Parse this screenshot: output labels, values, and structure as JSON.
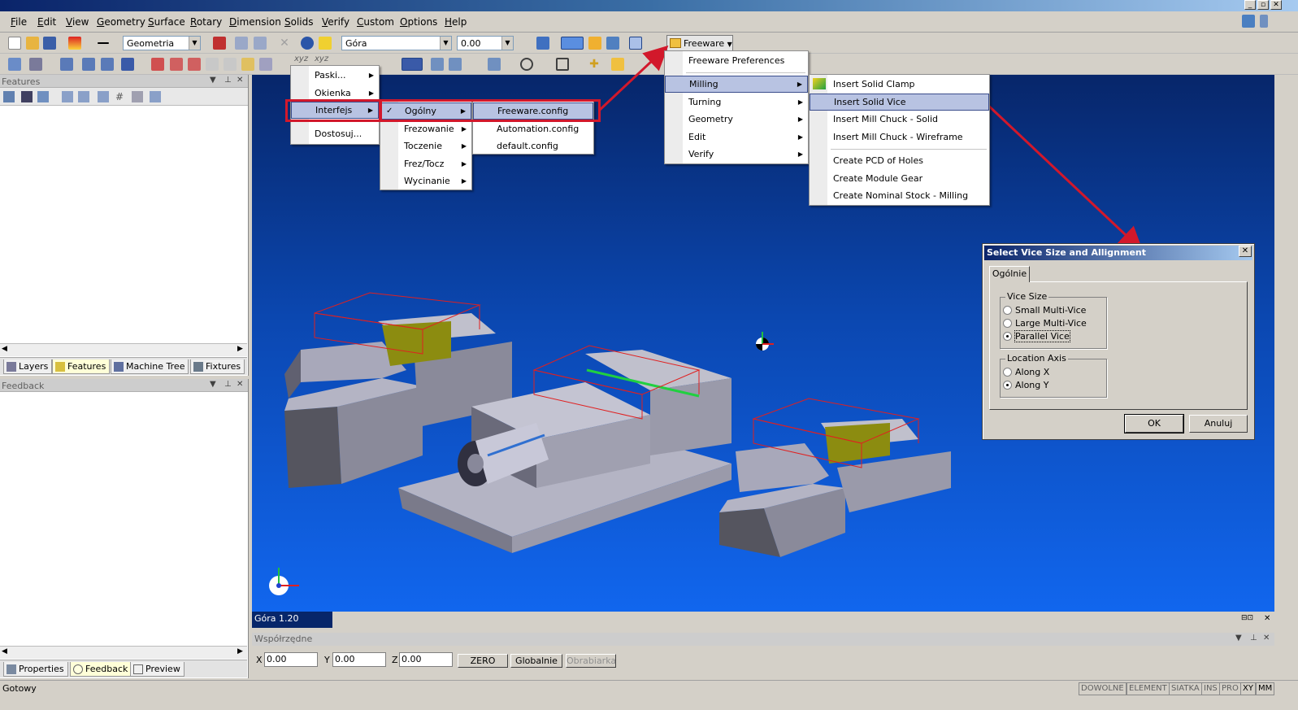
{
  "menubar": {
    "items": [
      "File",
      "Edit",
      "View",
      "Geometry",
      "Surface",
      "Rotary",
      "Dimension",
      "Solids",
      "Verify",
      "Custom",
      "Options",
      "Help"
    ]
  },
  "toolbar1": {
    "geometry_combo": "Geometria",
    "view_combo": "Góra",
    "depth_combo": "0.00",
    "freeware_button": "Freeware"
  },
  "toolbar2": {
    "xyz_label_1": "xyz",
    "xyz_label_2": "xyz"
  },
  "features_panel": {
    "title": "Features",
    "tabs": [
      "Layers",
      "Features",
      "Machine Tree",
      "Fixtures"
    ]
  },
  "feedback_panel": {
    "title": "Feedback",
    "tabs": [
      "Properties",
      "Feedback",
      "Preview"
    ]
  },
  "context_menu": {
    "items": [
      "Paski...",
      "Okienka",
      "Interfejs",
      "Dostosuj..."
    ]
  },
  "interfejs_submenu": {
    "items": [
      "Ogólny",
      "Frezowanie",
      "Toczenie",
      "Frez/Tocz",
      "Wycinanie"
    ]
  },
  "ogolny_submenu": {
    "items": [
      "Freeware.config",
      "Automation.config",
      "default.config"
    ]
  },
  "freeware_menu": {
    "items": [
      "Freeware Preferences",
      "Milling",
      "Turning",
      "Geometry",
      "Edit",
      "Verify"
    ]
  },
  "milling_submenu": {
    "items": [
      "Insert Solid Clamp",
      "Insert Solid Vice",
      "Insert Mill Chuck - Solid",
      "Insert Mill Chuck - Wireframe",
      "Create PCD of Holes",
      "Create Module Gear",
      "Create Nominal Stock - Milling"
    ]
  },
  "dialog": {
    "title": "Select Vice Size and Allignment",
    "tab": "Ogólnie",
    "vice_size_label": "Vice Size",
    "vice_options": [
      "Small Multi-Vice",
      "Large Multi-Vice",
      "Parallel Vice"
    ],
    "vice_selected": 2,
    "location_label": "Location Axis",
    "axis_options": [
      "Along X",
      "Along Y"
    ],
    "axis_selected": 1,
    "ok": "OK",
    "cancel": "Anuluj"
  },
  "viewport": {
    "view_label": "Góra 1.20"
  },
  "coords": {
    "title": "Współrzędne",
    "x_label": "X",
    "x_value": "0.00",
    "y_label": "Y",
    "y_value": "0.00",
    "z_label": "Z",
    "z_value": "0.00",
    "zero_button": "ZERO",
    "global_button": "Globalnie",
    "machine_button": "Obrabiarka"
  },
  "status": {
    "text": "Gotowy",
    "indicators": [
      "DOWOLNE",
      "ELEMENT",
      "SIATKA",
      "INS",
      "PRO",
      "XY",
      "MM"
    ]
  },
  "colors": {
    "menu_highlight": "#b8c3e2",
    "annotation_red": "#d2182b",
    "viewport_top": "#07266a",
    "viewport_bottom": "#1166ee"
  }
}
